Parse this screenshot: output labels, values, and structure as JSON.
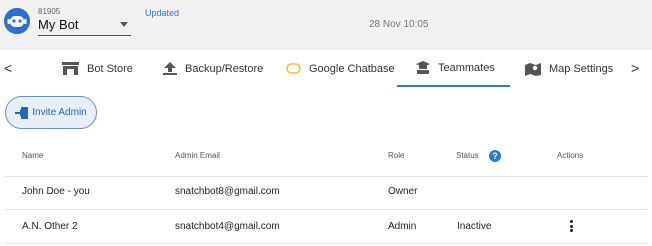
{
  "header": {
    "bot_id": "81905",
    "bot_name": "My Bot",
    "updated_label": "Updated",
    "datetime": "28 Nov 10:05"
  },
  "tabs": {
    "prev_arrow": "<",
    "next_arrow": ">",
    "items": [
      {
        "label": "Bot Store",
        "icon": "store-icon",
        "active": false
      },
      {
        "label": "Backup/Restore",
        "icon": "upload-icon",
        "active": false
      },
      {
        "label": "Google Chatbase",
        "icon": "chatbase-icon",
        "active": false
      },
      {
        "label": "Teammates",
        "icon": "teammates-icon",
        "active": true
      },
      {
        "label": "Map Settings",
        "icon": "map-icon",
        "active": false
      }
    ]
  },
  "actions": {
    "invite_label": "Invite Admin"
  },
  "table": {
    "headers": {
      "name": "Name",
      "email": "Admin Email",
      "role": "Role",
      "status": "Status",
      "actions": "Actions"
    },
    "rows": [
      {
        "name": "John Doe - you",
        "email": "snatchbot8@gmail.com",
        "role": "Owner",
        "status": ""
      },
      {
        "name": "A.N. Other 2",
        "email": "snatchbot4@gmail.com",
        "role": "Admin",
        "status": "Inactive"
      }
    ]
  },
  "colors": {
    "accent": "#2f78d1",
    "topbar_bg": "#f1f1f1",
    "button_bg": "#e7eef8"
  }
}
